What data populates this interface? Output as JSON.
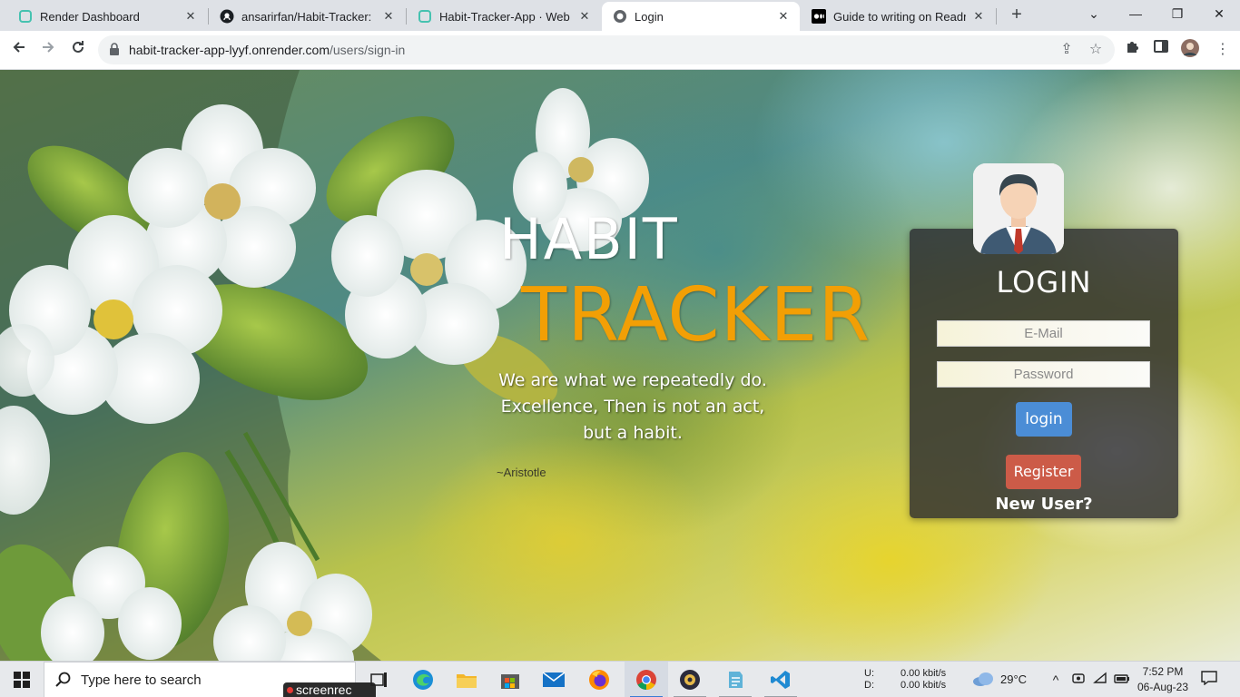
{
  "tabs": [
    {
      "title": "Render Dashboard",
      "icon": "render-icon",
      "close": "✕"
    },
    {
      "title": "ansarirfan/Habit-Tracker: Info",
      "icon": "github-icon",
      "close": "✕"
    },
    {
      "title": "Habit-Tracker-App · Web Ser",
      "icon": "render-icon",
      "close": "✕"
    },
    {
      "title": "Login",
      "icon": "globe-icon",
      "close": "✕",
      "active": true
    },
    {
      "title": "Guide to writing on Readme",
      "icon": "medium-icon",
      "close": "✕"
    }
  ],
  "address_bar": {
    "domain": "habit-tracker-app-lyyf.onrender.com",
    "path": "/users/sign-in"
  },
  "page": {
    "brand_line1": "HABIT",
    "brand_line2": "TRACKER",
    "quote_lines": [
      "We are what we repeatedly do.",
      "Excellence, Then is not an act,",
      "but a habit."
    ],
    "quote_author": "~Aristotle",
    "accent_color": "#f29f05"
  },
  "login": {
    "title": "LOGIN",
    "email_placeholder": "E-Mail",
    "password_placeholder": "Password",
    "login_label": "login",
    "register_label": "Register",
    "new_user_text": "New User?",
    "login_color": "#4b8dd6",
    "register_color": "#cc5b48"
  },
  "taskbar": {
    "search_placeholder": "Type here to search",
    "screenrec_label": "screenrec",
    "net_up_label": "U:",
    "net_down_label": "D:",
    "net_up": "0.00 kbit/s",
    "net_down": "0.00 kbit/s",
    "weather": "29°C",
    "time": "7:52 PM",
    "date": "06-Aug-23"
  }
}
